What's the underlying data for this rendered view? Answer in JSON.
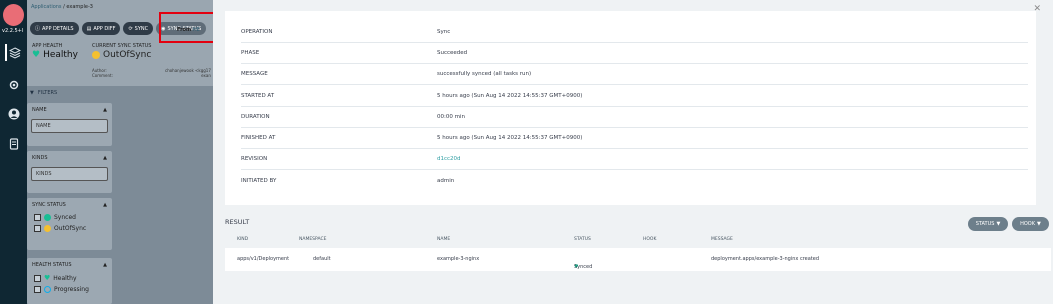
{
  "nav": {
    "version": "v2.2.5+l"
  },
  "breadcrumb": {
    "root": "Applications",
    "sep": "/",
    "current": "example-3"
  },
  "toolbar": {
    "app_details": "APP DETAILS",
    "app_diff": "APP DIFF",
    "sync": "SYNC",
    "sync_status": "SYNC STATUS"
  },
  "app_health": {
    "label": "APP HEALTH",
    "value": "Healthy"
  },
  "current_sync": {
    "label": "CURRENT SYNC STATUS",
    "value": "OutOfSync",
    "author": "Author:",
    "comment": "Comment:"
  },
  "from": {
    "label": "From",
    "ref": "HE"
  },
  "commit": {
    "line1": "chohanjewook <kgg17",
    "line2": "exan"
  },
  "filters": {
    "title": "FILTERS",
    "name": {
      "label": "NAME",
      "placeholder": "NAME"
    },
    "kinds": {
      "label": "KINDS",
      "placeholder": "KINDS"
    },
    "sync_status": {
      "label": "SYNC STATUS",
      "synced": "Synced",
      "out_of_sync": "OutOfSync"
    },
    "health_status": {
      "label": "HEALTH STATUS",
      "healthy": "Healthy",
      "progressing": "Progressing"
    }
  },
  "details": [
    {
      "key": "OPERATION",
      "value": "Sync"
    },
    {
      "key": "PHASE",
      "value": "Succeeded"
    },
    {
      "key": "MESSAGE",
      "value": "successfully synced (all tasks run)"
    },
    {
      "key": "STARTED AT",
      "value": "5 hours ago (Sun Aug 14 2022 14:55:37 GMT+0900)"
    },
    {
      "key": "DURATION",
      "value": "00:00 min"
    },
    {
      "key": "FINISHED AT",
      "value": "5 hours ago (Sun Aug 14 2022 14:55:37 GMT+0900)"
    },
    {
      "key": "REVISION",
      "value": "d1cc20d"
    },
    {
      "key": "INITIATED BY",
      "value": "admin"
    }
  ],
  "result": {
    "title": "RESULT",
    "status_filter": "STATUS",
    "hook_filter": "HOOK",
    "columns": {
      "kind": "KIND",
      "namespace": "NAMESPACE",
      "name": "NAME",
      "status": "STATUS",
      "hook": "HOOK",
      "message": "MESSAGE"
    },
    "rows": [
      {
        "kind": "apps/v1/Deployment",
        "namespace": "default",
        "name": "example-3-nginx",
        "status": "Synced",
        "hook": "",
        "message": "deployment.apps/example-3-nginx created"
      }
    ]
  },
  "colors": {
    "accent": "#18be94",
    "link": "#309ea3",
    "highlight": "#e3000f",
    "nav": "#0f2733"
  }
}
